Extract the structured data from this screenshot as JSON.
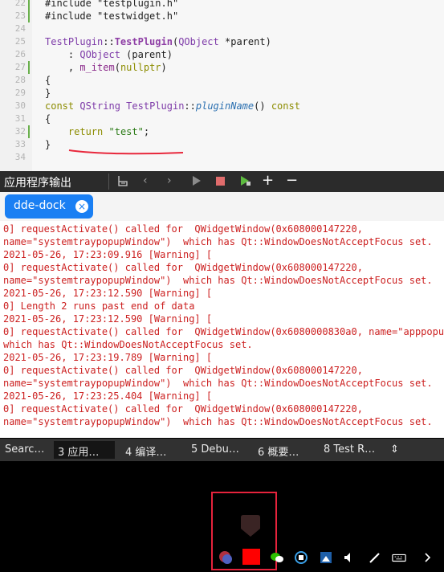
{
  "editor": {
    "lines": [
      {
        "num": "22",
        "parts": [
          {
            "t": "#include \"testplugin.h\"",
            "c": ""
          }
        ]
      },
      {
        "num": "23",
        "parts": [
          {
            "t": "#include \"testwidget.h\"",
            "c": ""
          }
        ]
      },
      {
        "num": "24",
        "parts": []
      },
      {
        "num": "25",
        "parts": [
          {
            "t": "TestPlugin",
            "c": "ty"
          },
          {
            "t": "::",
            "c": ""
          },
          {
            "t": "TestPlugin",
            "c": "cls"
          },
          {
            "t": "(",
            "c": ""
          },
          {
            "t": "QObject",
            "c": "ty"
          },
          {
            "t": " *parent)",
            "c": ""
          }
        ]
      },
      {
        "num": "26",
        "parts": [
          {
            "t": "    : ",
            "c": ""
          },
          {
            "t": "QObject",
            "c": "ty"
          },
          {
            "t": " (parent)",
            "c": ""
          }
        ]
      },
      {
        "num": "27",
        "parts": [
          {
            "t": "    , ",
            "c": ""
          },
          {
            "t": "m_item",
            "c": "mem"
          },
          {
            "t": "(",
            "c": ""
          },
          {
            "t": "nullptr",
            "c": "nul"
          },
          {
            "t": ")",
            "c": ""
          }
        ]
      },
      {
        "num": "28",
        "parts": [
          {
            "t": "{",
            "c": ""
          }
        ]
      },
      {
        "num": "29",
        "parts": [
          {
            "t": "}",
            "c": ""
          }
        ]
      },
      {
        "num": "30",
        "parts": [
          {
            "t": "const ",
            "c": "kw"
          },
          {
            "t": "QString",
            "c": "ty"
          },
          {
            "t": " ",
            "c": ""
          },
          {
            "t": "TestPlugin",
            "c": "ty"
          },
          {
            "t": "::",
            "c": ""
          },
          {
            "t": "pluginName",
            "c": "it"
          },
          {
            "t": "() ",
            "c": ""
          },
          {
            "t": "const",
            "c": "kw"
          }
        ]
      },
      {
        "num": "31",
        "parts": [
          {
            "t": "{",
            "c": ""
          }
        ]
      },
      {
        "num": "32",
        "parts": [
          {
            "t": "    ",
            "c": ""
          },
          {
            "t": "return",
            "c": "kw"
          },
          {
            "t": " ",
            "c": ""
          },
          {
            "t": "\"test\"",
            "c": "str"
          },
          {
            "t": ";",
            "c": ""
          }
        ]
      },
      {
        "num": "33",
        "parts": [
          {
            "t": "}",
            "c": ""
          }
        ]
      },
      {
        "num": "34",
        "parts": []
      }
    ]
  },
  "panel": {
    "title": "应用程序输出"
  },
  "tab": {
    "label": "dde-dock",
    "close": "×"
  },
  "output_lines": [
    "0] requestActivate() called for  QWidgetWindow(0x608000147220,",
    "name=\"systemtraypopupWindow\")  which has Qt::WindowDoesNotAcceptFocus set.",
    "2021-05-26, 17:23:09.916 [Warning] [",
    "0] requestActivate() called for  QWidgetWindow(0x608000147220,",
    "name=\"systemtraypopupWindow\")  which has Qt::WindowDoesNotAcceptFocus set.",
    "2021-05-26, 17:23:12.590 [Warning] [",
    "0] Length 2 runs past end of data",
    "2021-05-26, 17:23:12.590 [Warning] [",
    "0] requestActivate() called for  QWidgetWindow(0x6080000830a0, name=\"apppopup",
    "which has Qt::WindowDoesNotAcceptFocus set.",
    "2021-05-26, 17:23:19.789 [Warning] [",
    "0] requestActivate() called for  QWidgetWindow(0x608000147220,",
    "name=\"systemtraypopupWindow\")  which has Qt::WindowDoesNotAcceptFocus set.",
    "2021-05-26, 17:23:25.404 [Warning] [",
    "0] requestActivate() called for  QWidgetWindow(0x608000147220,",
    "name=\"systemtraypopupWindow\")  which has Qt::WindowDoesNotAcceptFocus set."
  ],
  "statusbar": {
    "search": "Searc…",
    "app_output": "3 应用…",
    "compile": "4 编译…",
    "debug": "5 Debu…",
    "overview": "6 概要…",
    "test": "8 Test R…",
    "more": "⇕"
  }
}
